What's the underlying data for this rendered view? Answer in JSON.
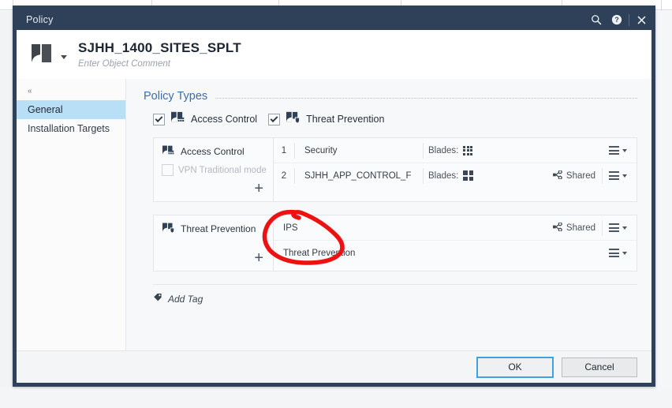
{
  "window": {
    "title": "Policy",
    "titlebar_icons": [
      "search-icon",
      "help-icon",
      "close-icon"
    ],
    "accent": "#2e4159"
  },
  "object_header": {
    "icon": "policy-book-icon",
    "name": "SJHH_1400_SITES_SPLT",
    "comment_placeholder": "Enter Object Comment"
  },
  "sidebar": {
    "collapse_glyph": "«",
    "items": [
      {
        "label": "General",
        "active": true
      },
      {
        "label": "Installation Targets",
        "active": false
      }
    ]
  },
  "content": {
    "section_title": "Policy Types",
    "policy_types": [
      {
        "label": "Access Control",
        "checked": true,
        "icon": "access-control-icon"
      },
      {
        "label": "Threat Prevention",
        "checked": true,
        "icon": "threat-prevention-icon"
      }
    ],
    "access_control_panel": {
      "title": "Access Control",
      "icon": "access-control-icon",
      "vpn_option": {
        "label": "VPN Traditional mode",
        "checked": false
      },
      "add_glyph": "+",
      "rows": [
        {
          "num": "1",
          "name": "Security",
          "blades_label": "Blades:",
          "blades_icon": "blades-grid-9-icon",
          "shared": "",
          "menu": "row-menu-icon"
        },
        {
          "num": "2",
          "name": "SJHH_APP_CONTROL_F",
          "blades_label": "Blades:",
          "blades_icon": "blades-grid-4-icon",
          "shared": "Shared",
          "menu": "row-menu-icon"
        }
      ]
    },
    "threat_prevention_panel": {
      "title": "Threat Prevention",
      "icon": "threat-prevention-icon",
      "add_glyph": "+",
      "rows": [
        {
          "name": "IPS",
          "shared": "Shared",
          "menu": "row-menu-icon"
        },
        {
          "name": "Threat Prevention",
          "shared": "",
          "menu": "row-menu-icon"
        }
      ]
    },
    "add_tag": {
      "label": "Add Tag",
      "icon": "tag-icon"
    }
  },
  "footer": {
    "ok_label": "OK",
    "cancel_label": "Cancel"
  },
  "annotation": {
    "type": "freehand-circle",
    "color": "#ee1111",
    "target": "IPS"
  }
}
